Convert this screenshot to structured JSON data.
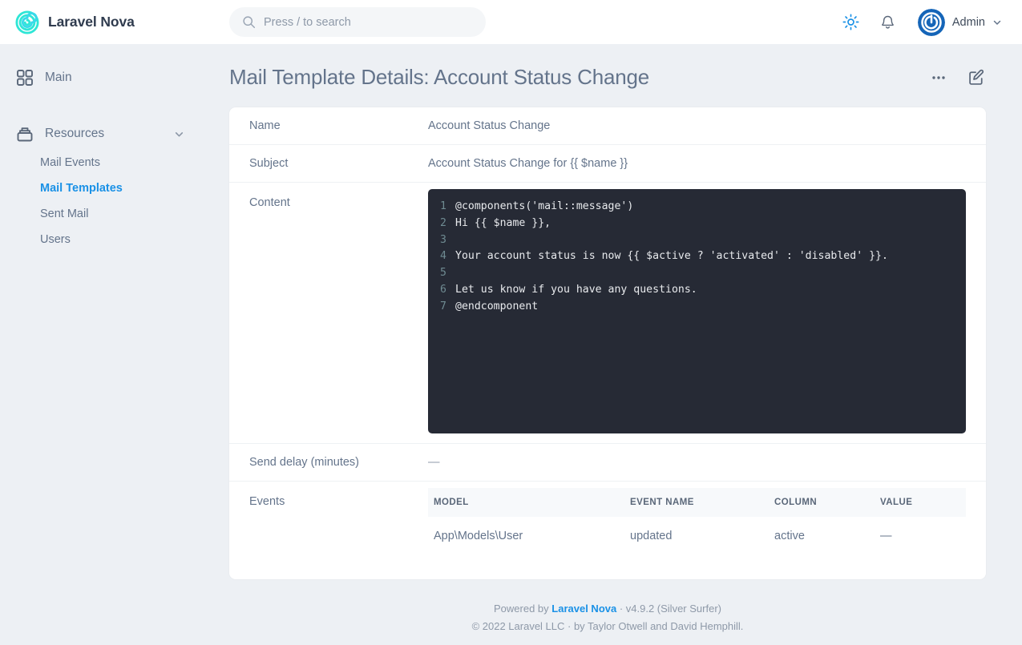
{
  "topbar": {
    "brand_name": "Laravel Nova",
    "brand_logo_icon": "nova-spiral-logo-icon",
    "search": {
      "placeholder": "Press / to search",
      "value": "",
      "icon": "search-icon"
    },
    "theme_toggle_icon": "sun-icon",
    "notifications_icon": "bell-icon",
    "user": {
      "name": "Admin",
      "avatar_icon": "power-avatar-icon",
      "chevron_icon": "chevron-down-icon"
    }
  },
  "sidebar": {
    "groups": [
      {
        "label": "Main",
        "icon": "grid-squares-icon",
        "collapsible": false,
        "items": []
      },
      {
        "label": "Resources",
        "icon": "archive-drawer-icon",
        "collapsible": true,
        "chevron_icon": "chevron-down-icon",
        "items": [
          {
            "label": "Mail Events",
            "active": false
          },
          {
            "label": "Mail Templates",
            "active": true
          },
          {
            "label": "Sent Mail",
            "active": false
          },
          {
            "label": "Users",
            "active": false
          }
        ]
      }
    ]
  },
  "page": {
    "title": "Mail Template Details: Account Status Change",
    "actions": {
      "more_icon": "ellipsis-horizontal-icon",
      "edit_icon": "pencil-square-icon"
    }
  },
  "detail": {
    "name": {
      "label": "Name",
      "value": "Account Status Change"
    },
    "subject": {
      "label": "Subject",
      "value": "Account Status Change for {{ $name }}"
    },
    "content": {
      "label": "Content",
      "lines": [
        {
          "n": "1",
          "text": "@components('mail::message')"
        },
        {
          "n": "2",
          "text": "Hi {{ $name }},"
        },
        {
          "n": "3",
          "text": ""
        },
        {
          "n": "4",
          "text": "Your account status is now {{ $active ? 'activated' : 'disabled' }}."
        },
        {
          "n": "5",
          "text": ""
        },
        {
          "n": "6",
          "text": "Let us know if you have any questions."
        },
        {
          "n": "7",
          "text": "@endcomponent"
        }
      ]
    },
    "send_delay": {
      "label": "Send delay (minutes)",
      "value": "—"
    },
    "events": {
      "label": "Events",
      "columns": [
        "MODEL",
        "EVENT NAME",
        "COLUMN",
        "VALUE"
      ],
      "rows": [
        {
          "model": "App\\Models\\User",
          "event_name": "updated",
          "column": "active",
          "value": "—"
        }
      ]
    }
  },
  "footer": {
    "powered_prefix": "Powered by ",
    "powered_link": "Laravel Nova",
    "version": " · v4.9.2 (Silver Surfer)",
    "copyright": "© 2022 Laravel LLC · by Taylor Otwell and David Hemphill."
  },
  "colors": {
    "accent": "#1a91e6",
    "brand_logo": "#2ee6d6",
    "page_bg": "#edf0f4",
    "card_bg": "#ffffff",
    "code_bg": "#262a35",
    "text_muted": "#64748b"
  }
}
